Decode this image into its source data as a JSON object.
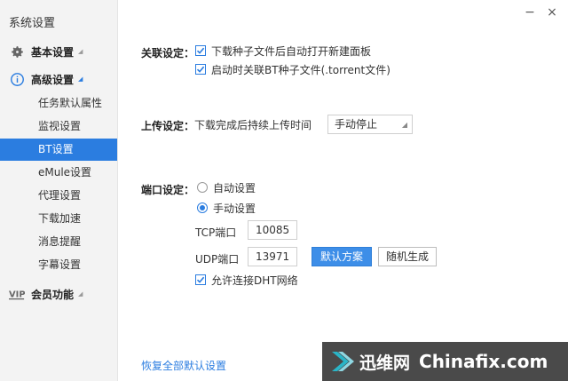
{
  "sidebar": {
    "title": "系统设置",
    "groups": {
      "basic": {
        "label": "基本设置"
      },
      "advanced": {
        "label": "高级设置"
      },
      "vip": {
        "label": "会员功能",
        "icon_text": "VIP"
      }
    },
    "items": [
      {
        "label": "任务默认属性"
      },
      {
        "label": "监视设置"
      },
      {
        "label": "BT设置"
      },
      {
        "label": "eMule设置"
      },
      {
        "label": "代理设置"
      },
      {
        "label": "下载加速"
      },
      {
        "label": "消息提醒"
      },
      {
        "label": "字幕设置"
      }
    ],
    "selected_index": 2
  },
  "window": {
    "minimize": "−",
    "close": "×"
  },
  "association": {
    "label": "关联设定：",
    "option1": "下载种子文件后自动打开新建面板",
    "option2": "启动时关联BT种子文件(.torrent文件)"
  },
  "upload": {
    "label": "上传设定：",
    "text": "下载完成后持续上传时间",
    "select_value": "手动停止"
  },
  "port": {
    "label": "端口设定：",
    "auto": "自动设置",
    "manual": "手动设置",
    "tcp_label": "TCP端口",
    "tcp_value": "10085",
    "udp_label": "UDP端口",
    "udp_value": "13971",
    "default_btn": "默认方案",
    "random_btn": "随机生成",
    "dht": "允许连接DHT网络"
  },
  "restore_link": "恢复全部默认设置",
  "watermark": {
    "cn": "迅维网",
    "en": "Chinafix.com"
  },
  "colors": {
    "accent": "#2b7de0",
    "sidebar_bg": "#f3f3f3"
  }
}
